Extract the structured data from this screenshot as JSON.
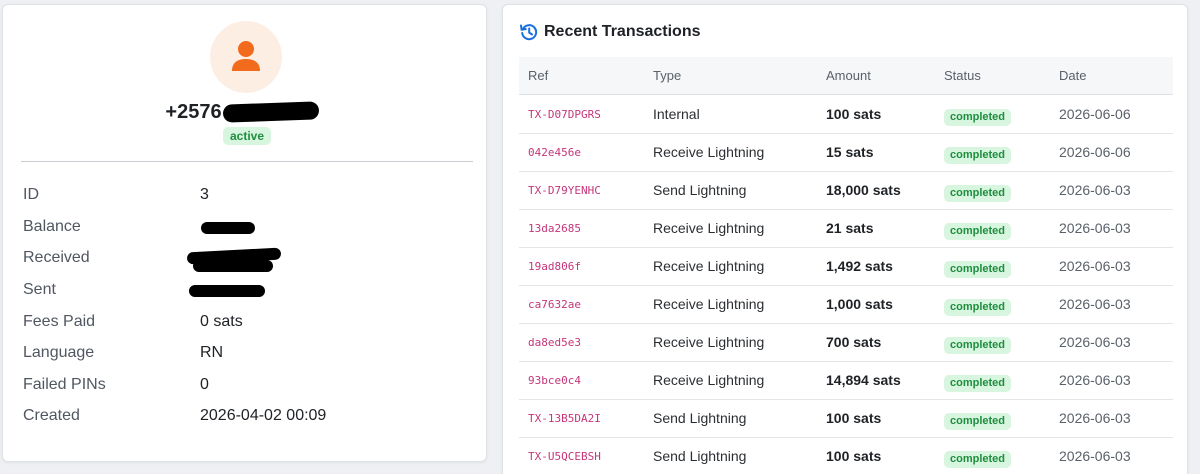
{
  "profile": {
    "phone": "+2576",
    "status": "active",
    "fields": [
      {
        "label": "ID",
        "value": "3"
      },
      {
        "label": "Balance",
        "value": ""
      },
      {
        "label": "Received",
        "value": ""
      },
      {
        "label": "Sent",
        "value": ""
      },
      {
        "label": "Fees Paid",
        "value": "0 sats"
      },
      {
        "label": "Language",
        "value": "RN"
      },
      {
        "label": "Failed PINs",
        "value": "0"
      },
      {
        "label": "Created",
        "value": "2026-04-02 00:09"
      }
    ],
    "colors": {
      "avatar_bg": "#fdeee4",
      "avatar_icon": "#f26a1b",
      "badge_green": "#1e8e3e"
    }
  },
  "transactions": {
    "title": "Recent Transactions",
    "title_icon": "history-icon",
    "columns": [
      "Ref",
      "Type",
      "Amount",
      "Status",
      "Date"
    ],
    "rows": [
      {
        "ref": "TX-D07DPGRS",
        "type": "Internal",
        "amount": "100 sats",
        "status": "completed",
        "date": "2026-06-06"
      },
      {
        "ref": "042e456e",
        "type": "Receive Lightning",
        "amount": "15 sats",
        "status": "completed",
        "date": "2026-06-06"
      },
      {
        "ref": "TX-D79YENHC",
        "type": "Send Lightning",
        "amount": "18,000 sats",
        "status": "completed",
        "date": "2026-06-03"
      },
      {
        "ref": "13da2685",
        "type": "Receive Lightning",
        "amount": "21 sats",
        "status": "completed",
        "date": "2026-06-03"
      },
      {
        "ref": "19ad806f",
        "type": "Receive Lightning",
        "amount": "1,492 sats",
        "status": "completed",
        "date": "2026-06-03"
      },
      {
        "ref": "ca7632ae",
        "type": "Receive Lightning",
        "amount": "1,000 sats",
        "status": "completed",
        "date": "2026-06-03"
      },
      {
        "ref": "da8ed5e3",
        "type": "Receive Lightning",
        "amount": "700 sats",
        "status": "completed",
        "date": "2026-06-03"
      },
      {
        "ref": "93bce0c4",
        "type": "Receive Lightning",
        "amount": "14,894 sats",
        "status": "completed",
        "date": "2026-06-03"
      },
      {
        "ref": "TX-13B5DA2I",
        "type": "Send Lightning",
        "amount": "100 sats",
        "status": "completed",
        "date": "2026-06-03"
      },
      {
        "ref": "TX-U5QCEBSH",
        "type": "Send Lightning",
        "amount": "100 sats",
        "status": "completed",
        "date": "2026-06-03"
      }
    ]
  }
}
